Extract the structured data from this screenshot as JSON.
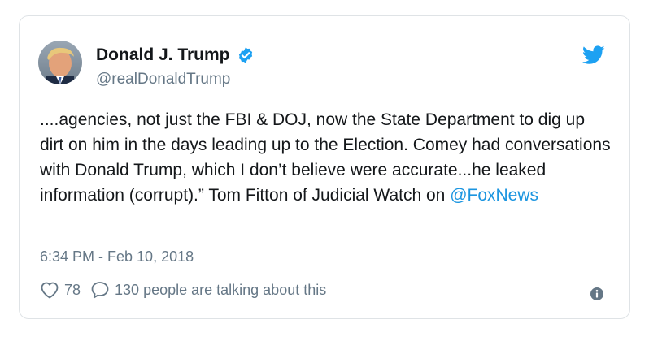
{
  "tweet": {
    "author_name": "Donald J. Trump",
    "handle": "@realDonaldTrump",
    "text_before_mention": "....agencies, not just the FBI & DOJ, now the State Department to dig up dirt on him in the days leading up to the Election. Comey had conversations with Donald Trump, which I don’t believe were accurate...he leaked information (corrupt).” Tom Fitton of Judicial Watch on ",
    "mention": "@FoxNews",
    "timestamp": "6:34 PM - Feb 10, 2018",
    "likes": "78",
    "talking_text": "130 people are talking about this",
    "icons": {
      "verified": "verified-badge-icon",
      "brand": "twitter-bird-icon",
      "like": "heart-icon",
      "reply": "speech-bubble-icon",
      "info": "info-icon"
    }
  },
  "colors": {
    "accent": "#1da1f2",
    "link": "#1b95e0",
    "text": "#14171a",
    "muted": "#657786",
    "border": "#dfe3e6"
  }
}
